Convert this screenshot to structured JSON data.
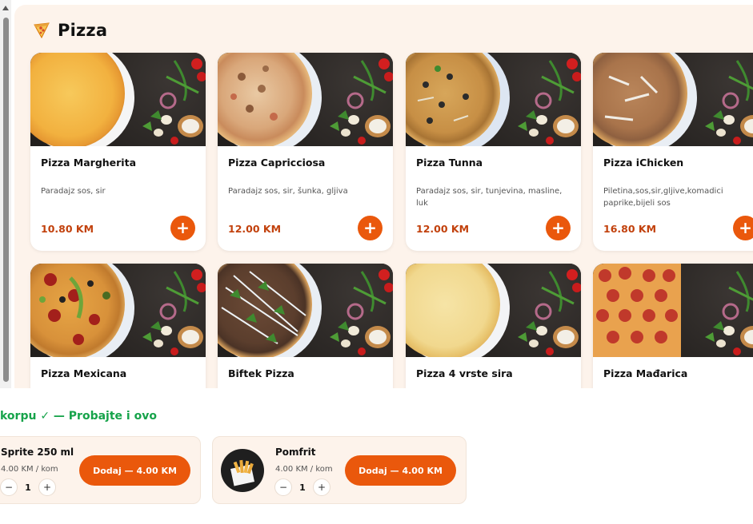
{
  "section": {
    "title": "Pizza",
    "icon": "pizza-slice-icon"
  },
  "pizzas": [
    {
      "name": "Pizza Margherita",
      "desc": "Paradajz sos, sir",
      "price": "10.80 KM",
      "add": "+"
    },
    {
      "name": "Pizza Capricciosa",
      "desc": "Paradajz sos, sir, šunka, gljiva",
      "price": "12.00 KM",
      "add": "+"
    },
    {
      "name": "Pizza Tunna",
      "desc": "Paradajz sos, sir, tunjevina, masline, luk",
      "price": "12.00 KM",
      "add": "+"
    },
    {
      "name": "Pizza iChicken",
      "desc": "Piletina,sos,sir,gljive,komadici paprike,bijeli sos",
      "price": "16.80 KM",
      "add": "+"
    },
    {
      "name": "Pizza Mexicana"
    },
    {
      "name": "Biftek Pizza"
    },
    {
      "name": "Pizza 4 vrste sira"
    },
    {
      "name": "Pizza Mađarica"
    }
  ],
  "upsell": {
    "title": "korpu ✓ — Probajte i ovo",
    "items": [
      {
        "name": "Sprite 250 ml",
        "price": "4.00 KM / kom",
        "minus": "−",
        "qty": "1",
        "plus": "+",
        "button": "Dodaj — 4.00 KM"
      },
      {
        "name": "Pomfrit",
        "price": "4.00 KM / kom",
        "minus": "−",
        "qty": "1",
        "plus": "+",
        "button": "Dodaj — 4.00 KM"
      }
    ]
  },
  "colors": {
    "accent": "#ea580c",
    "price": "#c2410c",
    "panel": "#fdf3eb",
    "success": "#16a34a"
  }
}
